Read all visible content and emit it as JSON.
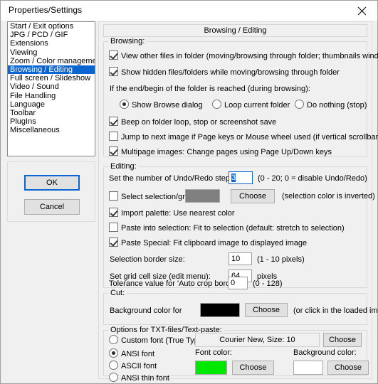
{
  "window": {
    "title": "Properties/Settings",
    "close_icon": "close-icon"
  },
  "sidebar": {
    "items": [
      {
        "label": "Start / Exit options",
        "selected": false
      },
      {
        "label": "JPG / PCD / GIF",
        "selected": false
      },
      {
        "label": "Extensions",
        "selected": false
      },
      {
        "label": "Viewing",
        "selected": false
      },
      {
        "label": "Zoom / Color management",
        "selected": false
      },
      {
        "label": "Browsing / Editing",
        "selected": true
      },
      {
        "label": "Full screen / Slideshow",
        "selected": false
      },
      {
        "label": "Video / Sound",
        "selected": false
      },
      {
        "label": "File Handling",
        "selected": false
      },
      {
        "label": "Language",
        "selected": false
      },
      {
        "label": "Toolbar",
        "selected": false
      },
      {
        "label": "PlugIns",
        "selected": false
      },
      {
        "label": "Miscellaneous",
        "selected": false
      }
    ],
    "ok_label": "OK",
    "cancel_label": "Cancel"
  },
  "panel": {
    "tab_title": "Browsing / Editing",
    "browsing": {
      "legend": "Browsing:",
      "cb_view_other": {
        "label": "View other files in folder (moving/browsing through folder; thumbnails window)",
        "checked": true
      },
      "cb_show_hidden": {
        "label": "Show hidden files/folders while moving/browsing through folder",
        "checked": true
      },
      "end_begin_label": "If the end/begin of the folder is reached (during browsing):",
      "radios": [
        {
          "label": "Show Browse dialog",
          "selected": true
        },
        {
          "label": "Loop current folder",
          "selected": false
        },
        {
          "label": "Do nothing (stop)",
          "selected": false
        }
      ],
      "cb_beep": {
        "label": "Beep on folder loop, stop or screenshot save",
        "checked": true
      },
      "cb_jump": {
        "label": "Jump to next image if Page keys or Mouse wheel used (if vertical scrollbar visible)",
        "checked": false
      },
      "cb_multipage": {
        "label": "Multipage images: Change pages using Page Up/Down keys",
        "checked": true
      }
    },
    "editing": {
      "legend": "Editing:",
      "undo_label": "Set the number of Undo/Redo steps:",
      "undo_value": "3",
      "undo_hint": "(0 - 20; 0 = disable Undo/Redo)",
      "cb_sel_grid_color": {
        "label": "Select selection/grid color",
        "checked": false
      },
      "sel_grid_swatch": "#808080",
      "sel_grid_choose": "Choose",
      "sel_grid_hint": "(selection color is inverted)",
      "cb_import_palette": {
        "label": "Import palette: Use nearest color",
        "checked": true
      },
      "cb_paste_into": {
        "label": "Paste into selection: Fit to selection (default: stretch to selection)",
        "checked": false
      },
      "cb_paste_special": {
        "label": "Paste Special: Fit clipboard image to displayed image",
        "checked": true
      },
      "border_label": "Selection border size:",
      "border_value": "10",
      "border_hint": "(1 - 10 pixels)",
      "grid_label": "Set grid cell size (edit menu):",
      "grid_value": "64",
      "grid_hint": "pixels",
      "tolerance_label": "Tolerance value for 'Auto crop borders':",
      "tolerance_value": "0",
      "tolerance_hint": "(0 - 128)"
    },
    "cut": {
      "legend": "Cut:",
      "bg_label": "Background  color for",
      "bg_swatch": "#000000",
      "bg_choose": "Choose",
      "bg_hint": "(or click in the loaded image)"
    },
    "txt_options": {
      "legend": "Options for TXT-files/Text-paste:",
      "radios": [
        {
          "label": "Custom font (True Type):",
          "selected": false
        },
        {
          "label": "ANSI font",
          "selected": true
        },
        {
          "label": "ASCII font",
          "selected": false
        },
        {
          "label": "ANSI thin font",
          "selected": false
        }
      ],
      "font_value": "Courier New, Size: 10",
      "font_choose": "Choose",
      "font_color_label": "Font color:",
      "font_color_swatch": "#00e800",
      "font_color_choose": "Choose",
      "bg_color_label": "Background color:",
      "bg_color_swatch": "#ffffff",
      "bg_color_choose": "Choose"
    }
  }
}
